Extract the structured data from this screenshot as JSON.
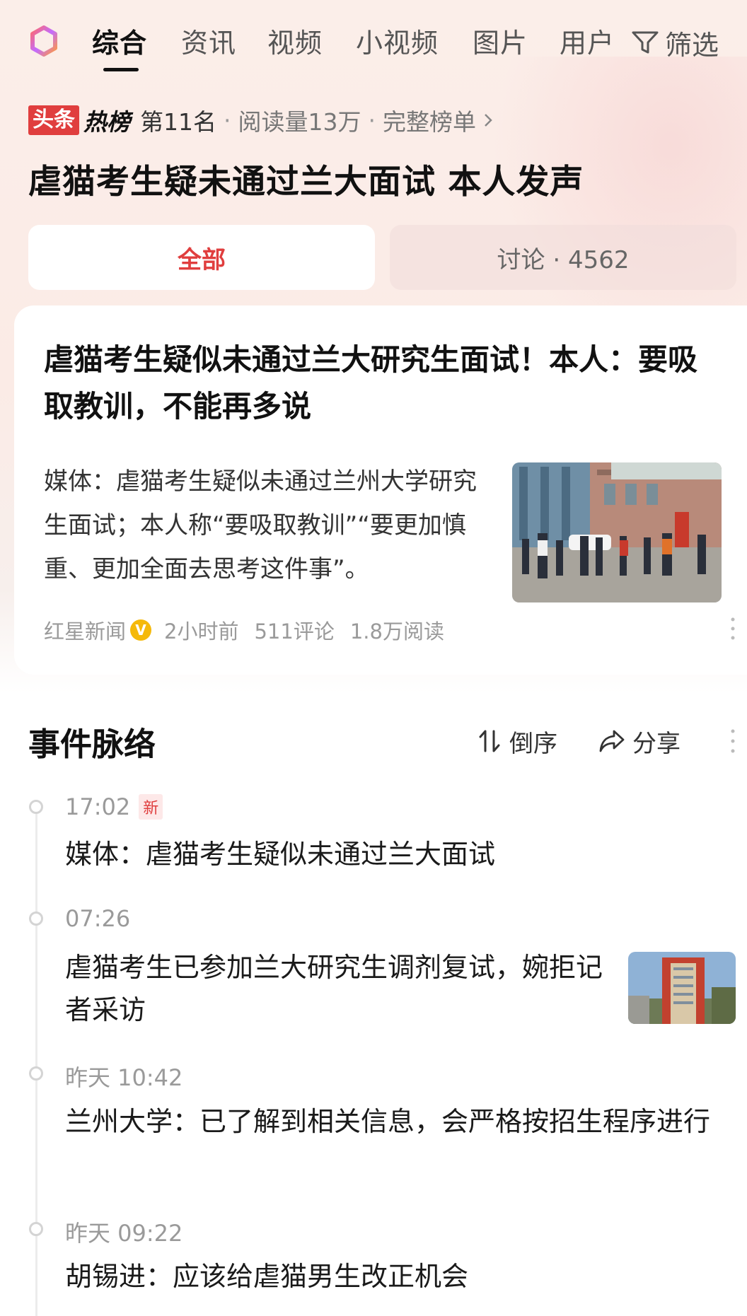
{
  "tabs": [
    {
      "label": "综合",
      "active": true
    },
    {
      "label": "资讯"
    },
    {
      "label": "视频"
    },
    {
      "label": "小视频"
    },
    {
      "label": "图片"
    },
    {
      "label": "用户"
    }
  ],
  "filter_label": "筛选",
  "hotlist": {
    "source_badge": "头条",
    "list_badge": "热榜",
    "rank": "第11名",
    "reads": "阅读量13万",
    "full_list": "完整榜单"
  },
  "headline": "虐猫考生疑未通过兰大面试 本人发声",
  "segments": {
    "all": "全部",
    "discussion": "讨论 · 4562"
  },
  "article": {
    "title": "虐猫考生疑似未通过兰大研究生面试！本人：要吸取教训，不能再多说",
    "summary": "媒体：虐猫考生疑似未通过兰州大学研究生面试；本人称“要吸取教训”“要更加慎重、更加全面去思考这件事”。",
    "source": "红星新闻",
    "verified_mark": "V",
    "time": "2小时前",
    "comments": "511评论",
    "reads": "1.8万阅读"
  },
  "timeline": {
    "heading": "事件脉络",
    "sort_label": "倒序",
    "share_label": "分享",
    "new_badge": "新",
    "items": [
      {
        "time": "17:02",
        "text": "媒体：虐猫考生疑似未通过兰大面试",
        "is_new": true
      },
      {
        "time": "07:26",
        "text": "虐猫考生已参加兰大研究生调剂复试，婉拒记者采访",
        "has_thumb": true
      },
      {
        "time": "昨天 10:42",
        "text": "兰州大学：已了解到相关信息，会严格按招生程序进行"
      },
      {
        "time": "昨天 09:22",
        "text": "胡锡进：应该给虐猫男生改正机会"
      }
    ]
  },
  "colors": {
    "accent_red": "#e03e3e",
    "muted_text": "#9a9a9a",
    "verified_yellow": "#f5b90a"
  }
}
